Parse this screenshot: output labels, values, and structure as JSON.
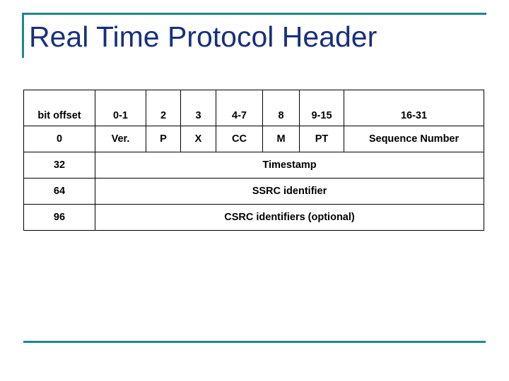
{
  "slide": {
    "title": "Real Time Protocol  Header",
    "accent_color": "#1d878d",
    "title_color": "#17307c",
    "background_color": "#ffffff"
  },
  "table": {
    "header_row": {
      "offset_label": "bit offset",
      "bits": [
        "0-1",
        "2",
        "3",
        "4-7",
        "8",
        "9-15",
        "16-31"
      ]
    },
    "rows": [
      {
        "offset": "0",
        "type": "fields",
        "cells": [
          "Ver.",
          "P",
          "X",
          "CC",
          "M",
          "PT",
          "Sequence Number"
        ]
      },
      {
        "offset": "32",
        "type": "span",
        "cells": [
          "Timestamp"
        ]
      },
      {
        "offset": "64",
        "type": "span",
        "cells": [
          "SSRC identifier"
        ]
      },
      {
        "offset": "96",
        "type": "span",
        "cells": [
          "CSRC identifiers (optional)"
        ]
      }
    ]
  }
}
